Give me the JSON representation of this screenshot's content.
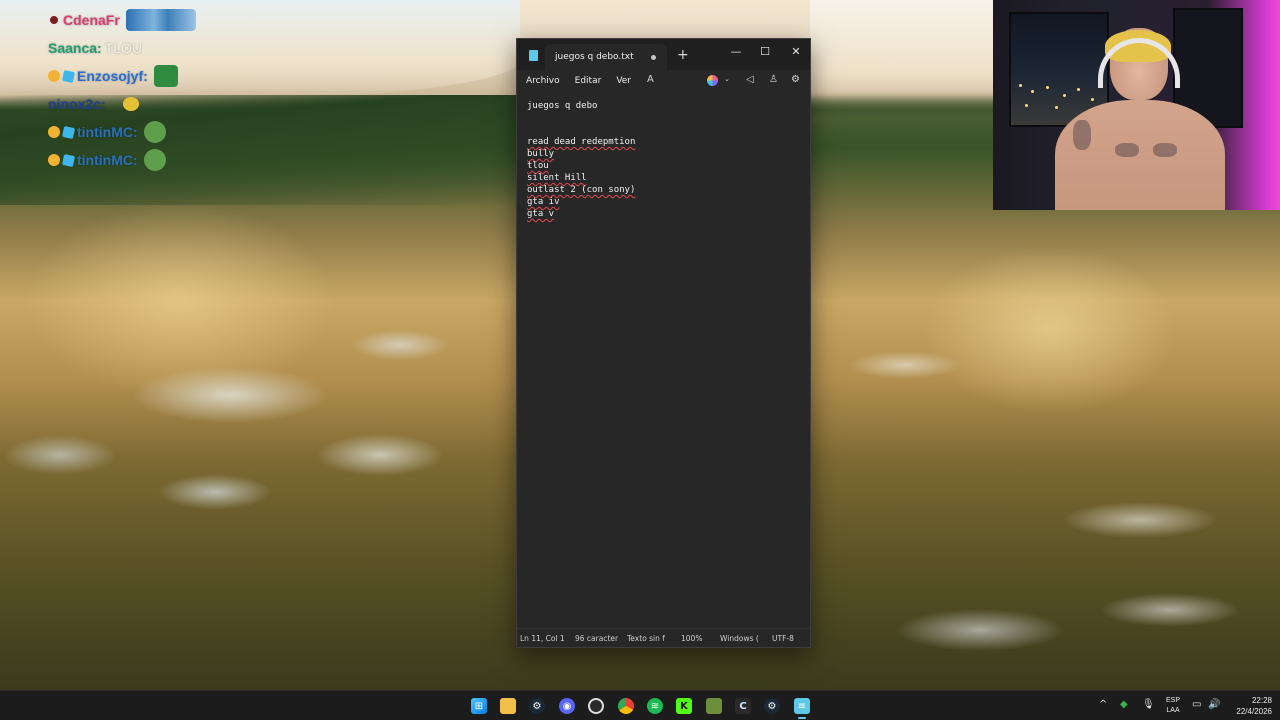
{
  "chat": {
    "messages": [
      {
        "user": "CdenaFr",
        "text": "",
        "user_color": "#d93e6e"
      },
      {
        "user": "Saanca:",
        "text": "TLOU",
        "user_color": "#1f9f6f"
      },
      {
        "user": "Enzosojyf:",
        "text": "",
        "user_color": "#2a6fd1"
      },
      {
        "user": "ninox2c:",
        "text": "",
        "user_color": "#1d3f8f"
      },
      {
        "user": "tintinMC:",
        "text": "",
        "user_color": "#2b6fb9"
      },
      {
        "user": "tintinMC:",
        "text": "",
        "user_color": "#2b6fb9"
      }
    ]
  },
  "notepad": {
    "tab_title": "juegos q debo.txt",
    "new_tab": "+",
    "window_controls": {
      "minimize": "—",
      "maximize": "☐",
      "close": "✕"
    },
    "menu": {
      "file": "Archivo",
      "edit": "Editar",
      "view": "Ver"
    },
    "lines": [
      {
        "text": "juegos q debo",
        "spell_error": false
      },
      {
        "text": "",
        "spell_error": false
      },
      {
        "text": "",
        "spell_error": false
      },
      {
        "text": "read dead redepmtion",
        "spell_error": true
      },
      {
        "text": "bully",
        "spell_error": true
      },
      {
        "text": "tlou",
        "spell_error": true
      },
      {
        "text": "silent Hill",
        "spell_error": true
      },
      {
        "text": "outlast 2 (con sony)",
        "spell_error": true
      },
      {
        "text": "gta iv",
        "spell_error": true
      },
      {
        "text": "gta v",
        "spell_error": true
      }
    ],
    "status": {
      "position": "Ln 11, Col 1",
      "characters": "96 caracter",
      "format": "Texto sin f",
      "zoom": "100%",
      "line_ending": "Windows (",
      "encoding": "UTF-8"
    }
  },
  "taskbar": {
    "apps": [
      "start-icon",
      "file-explorer-icon",
      "steam-icon",
      "discord-icon",
      "obs-icon",
      "chrome-icon",
      "spotify-icon",
      "kick-icon",
      "minecraft-icon",
      "ccleaner-icon",
      "steam-alt-icon",
      "notepad-icon"
    ],
    "language_line1": "ESP",
    "language_line2": "LAA",
    "time": "22:28",
    "date": "22/4/2026"
  },
  "colors": {
    "notepad_bg": "#272727",
    "titlebar_bg": "#1f1f1f",
    "spell_underline": "#e0484d",
    "taskbar_bg": "#1c1c1c"
  }
}
